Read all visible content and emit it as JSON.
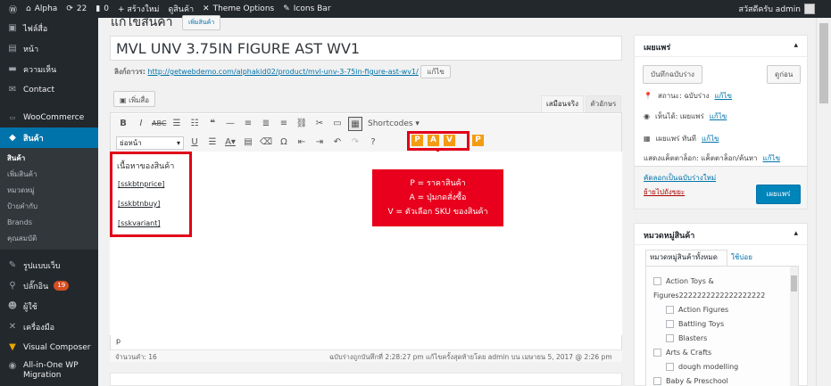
{
  "adminbar": {
    "site_name": "Alpha",
    "updates_count": "22",
    "comments_count": "0",
    "new_label": "+ สร้างใหม่",
    "product_label": "ดูสินค้า",
    "theme_options": "Theme Options",
    "icons_bar": "Icons Bar",
    "greeting": "สวัสดีครับ admin"
  },
  "sidebar": {
    "items": [
      {
        "label": "ไฟล์สื่อ",
        "icon": "media-icon"
      },
      {
        "label": "หน้า",
        "icon": "page-icon"
      },
      {
        "label": "ความเห็น",
        "icon": "comment-icon"
      },
      {
        "label": "Contact",
        "icon": "mail-icon"
      },
      {
        "label": "WooCommerce",
        "icon": "woo-icon"
      },
      {
        "label": "สินค้า",
        "icon": "product-icon"
      }
    ],
    "submenu": [
      "สินค้า",
      "เพิ่มสินค้า",
      "หมวดหมู่",
      "ป้ายคำกับ",
      "Brands",
      "คุณสมบัติ"
    ],
    "lower_items": [
      {
        "label": "รูปแบบเว็บ",
        "icon": "appearance-icon"
      },
      {
        "label": "ปลั๊กอิน",
        "icon": "plugin-icon",
        "badge": "19"
      },
      {
        "label": "ผู้ใช้",
        "icon": "user-icon"
      },
      {
        "label": "เครื่องมือ",
        "icon": "tools-icon"
      },
      {
        "label": "Visual Composer",
        "icon": "vc-icon"
      },
      {
        "label": "All-in-One WP Migration",
        "icon": "migration-icon"
      }
    ]
  },
  "page": {
    "heading": "แก้ไขสินค้า",
    "add_new": "เพิ่มสินค้า",
    "title_value": "MVL UNV 3.75IN FIGURE AST WV1",
    "permalink_label": "ลิงก์ถาวร:",
    "permalink_url": "http://getwebdemo.com/alphakid02/product/mvl-unv-3-75in-figure-ast-wv1/",
    "edit_button": "แก้ไข",
    "add_media": "เพิ่มสื่อ",
    "tab_visual": "เสมือนจริง",
    "tab_text": "ตัวอักษร"
  },
  "toolbar": {
    "shortcodes": "Shortcodes ▾",
    "format_select": "ย่อหน้า",
    "shortcode_buttons": [
      "P",
      "A",
      "V",
      "P"
    ]
  },
  "content": {
    "heading": "เนื้อหาของสินค้า",
    "shortcodes": [
      "[sskbtnprice]",
      "[sskbtnbuy]",
      "[sskvariant]"
    ],
    "path": "p",
    "word_count": "จำนวนคำ: 16",
    "autosave": "ฉบับร่างถูกบันทึกที่ 2:28:27 pm แก้ไขครั้งสุดท้ายโดย admin บน เมษายน 5, 2017 @ 2:26 pm"
  },
  "callout": {
    "lines": [
      "P = ราคาสินค้า",
      "A = ปุ่มกดสั่งซื้อ",
      "V = ตัวเลือก SKU ของสินค้า"
    ]
  },
  "publish": {
    "title": "เผยแพร่",
    "save_draft": "บันทึกฉบับร่าง",
    "preview": "ดูก่อน",
    "status": "สถานะ: ฉบับร่าง",
    "visibility": "เห็นได้: เผยแพร่",
    "schedule": "เผยแพร่ ทันที",
    "edit_link": "แก้ไข",
    "catalog": "แสดงแค็ตตาล็อก: แค็ตตาล็อก/ค้นหา",
    "copy_draft": "คัดลอกเป็นฉบับร่างใหม่",
    "trash": "ย้ายไปถังขยะ",
    "publish_button": "เผยแพร่"
  },
  "categories": {
    "title": "หมวดหมู่สินค้า",
    "tab_all": "หมวดหมู่สินค้าทั้งหมด",
    "tab_popular": "ใช้บ่อย",
    "items": [
      {
        "label": "Action Toys &",
        "level": 0,
        "checkbox": true
      },
      {
        "label": "Figures2222222222222222222",
        "level": 0,
        "checkbox": false
      },
      {
        "label": "Action Figures",
        "level": 1,
        "checkbox": true
      },
      {
        "label": "Battling Toys",
        "level": 1,
        "checkbox": true
      },
      {
        "label": "Blasters",
        "level": 1,
        "checkbox": true
      },
      {
        "label": "Arts & Crafts",
        "level": 0,
        "checkbox": true
      },
      {
        "label": "dough modelling",
        "level": 1,
        "checkbox": true
      },
      {
        "label": "Baby & Preschool",
        "level": 0,
        "checkbox": true
      }
    ]
  },
  "colors": {
    "accent": "#0073aa",
    "annotation_red": "#e1001a",
    "shortcode_orange": "#f39c12"
  }
}
